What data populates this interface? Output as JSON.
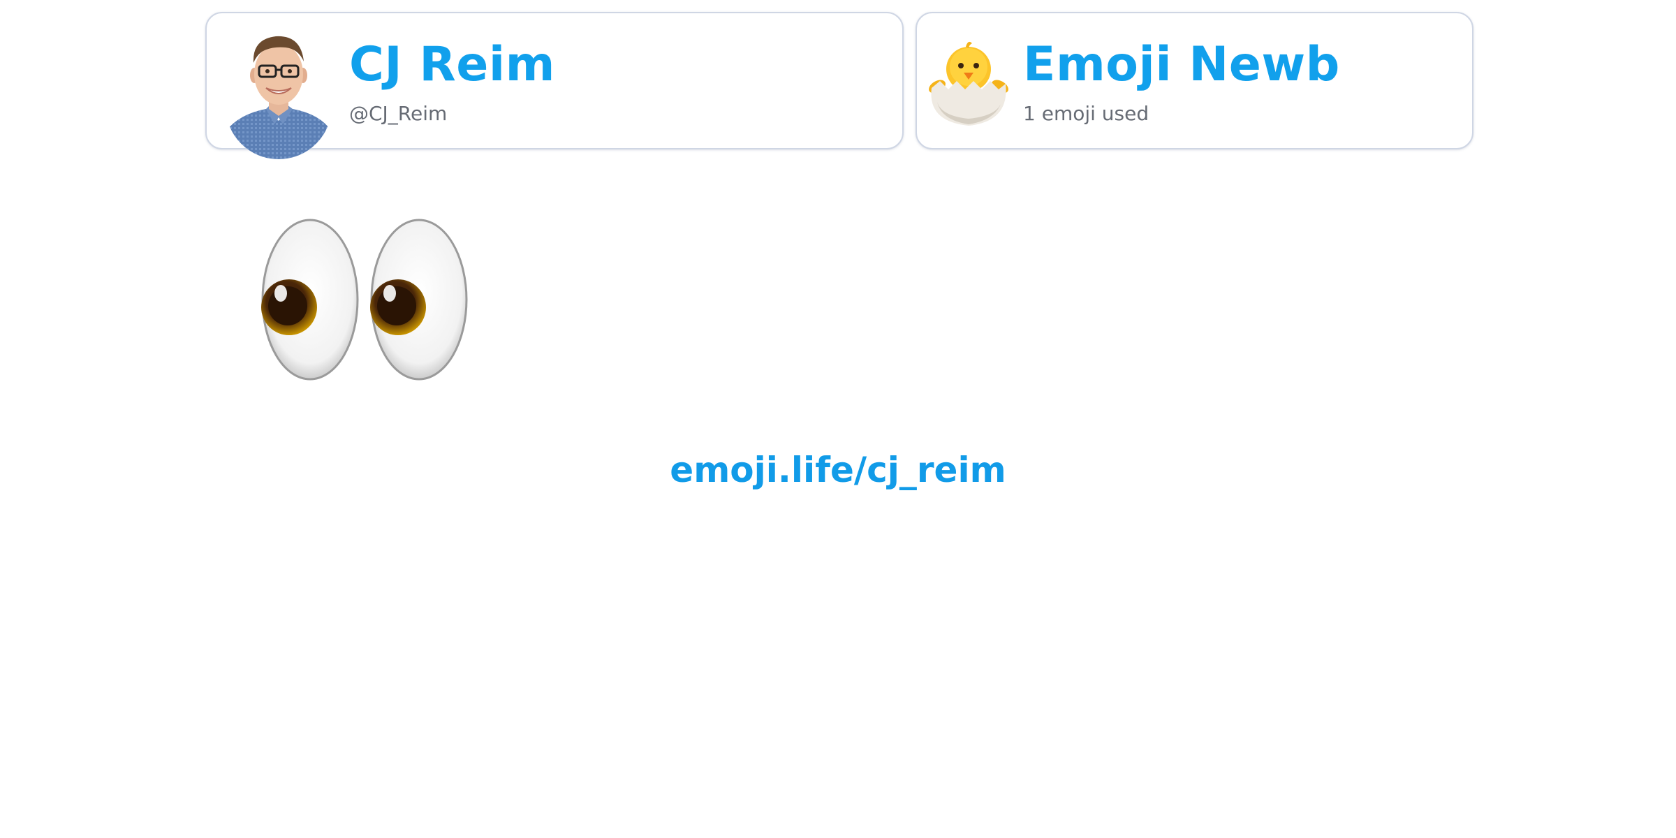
{
  "profile": {
    "name": "CJ Reim",
    "handle": "@CJ_Reim",
    "avatar_icon": "profile-photo"
  },
  "badge": {
    "title": "Emoji Newb",
    "subtitle": "1 emoji used",
    "icon": "hatching-chick-icon"
  },
  "emojis": [
    {
      "icon": "eyes-icon"
    }
  ],
  "link": {
    "text": "emoji.life/cj_reim"
  },
  "colors": {
    "accent": "#11a0ec",
    "muted_text": "#666b74",
    "card_border": "#cfd6e4"
  }
}
